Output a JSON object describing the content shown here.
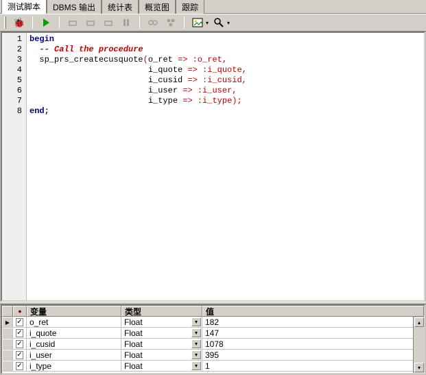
{
  "tabs": [
    {
      "label": "测试脚本",
      "active": true
    },
    {
      "label": "DBMS 输出",
      "active": false
    },
    {
      "label": "统计表",
      "active": false
    },
    {
      "label": "概览图",
      "active": false
    },
    {
      "label": "跟踪",
      "active": false
    }
  ],
  "code": {
    "lines": [
      {
        "n": "1",
        "kind": "kw",
        "text": "begin"
      },
      {
        "n": "2",
        "kind": "cm",
        "text": "  -- Call the procedure"
      },
      {
        "n": "3",
        "kind": "call",
        "proc": "  sp_prs_createcusquote",
        "param": "o_ret",
        "bind": ":o_ret",
        "tail": ","
      },
      {
        "n": "4",
        "kind": "param",
        "indent": "                        ",
        "param": "i_quote",
        "bind": ":i_quote",
        "tail": ","
      },
      {
        "n": "5",
        "kind": "param",
        "indent": "                        ",
        "param": "i_cusid",
        "bind": ":i_cusid",
        "tail": ","
      },
      {
        "n": "6",
        "kind": "param",
        "indent": "                        ",
        "param": "i_user",
        "bind": ":i_user",
        "tail": ","
      },
      {
        "n": "7",
        "kind": "param",
        "indent": "                        ",
        "param": "i_type",
        "bind": ":i_type",
        "tail": ");"
      },
      {
        "n": "8",
        "kind": "kw",
        "text": "end;"
      }
    ]
  },
  "vars": {
    "headers": {
      "name": "变量",
      "type": "类型",
      "value": "值"
    },
    "rows": [
      {
        "ptr": true,
        "checked": true,
        "name": "o_ret",
        "type": "Float",
        "value": "182"
      },
      {
        "ptr": false,
        "checked": true,
        "name": "i_quote",
        "type": "Float",
        "value": "147"
      },
      {
        "ptr": false,
        "checked": true,
        "name": "i_cusid",
        "type": "Float",
        "value": "1078"
      },
      {
        "ptr": false,
        "checked": true,
        "name": "i_user",
        "type": "Float",
        "value": "395"
      },
      {
        "ptr": false,
        "checked": true,
        "name": "i_type",
        "type": "Float",
        "value": "1"
      }
    ]
  }
}
